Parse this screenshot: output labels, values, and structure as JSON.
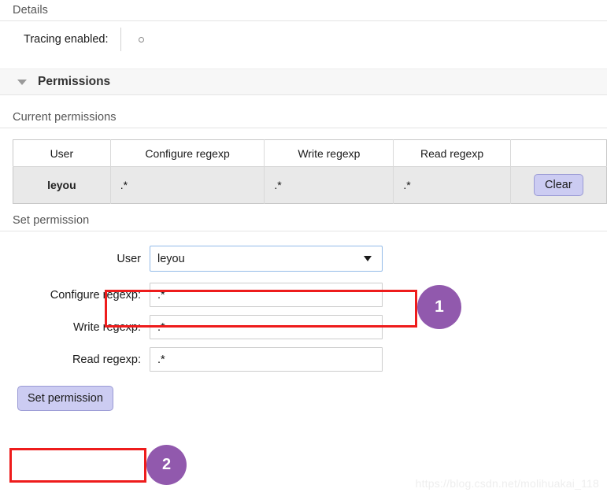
{
  "details": {
    "heading": "Details",
    "tracing_label": "Tracing enabled:",
    "tracing_value_icon": "small-circle-icon"
  },
  "permissions_section": {
    "title": "Permissions",
    "toggle_icon": "chevron-down-icon",
    "current_permissions_heading": "Current permissions",
    "table": {
      "columns": [
        "User",
        "Configure regexp",
        "Write regexp",
        "Read regexp",
        ""
      ],
      "rows": [
        {
          "user": "leyou",
          "configure_regexp": ".*",
          "write_regexp": ".*",
          "read_regexp": ".*",
          "action_label": "Clear"
        }
      ]
    }
  },
  "set_permission": {
    "heading": "Set permission",
    "user_label": "User",
    "user_value": "leyou",
    "user_options": [
      "leyou"
    ],
    "dropdown_icon": "triangle-down-icon",
    "fields": [
      {
        "label": "Configure regexp:",
        "value": ".*",
        "name": "configure-regexp-input"
      },
      {
        "label": "Write regexp:",
        "value": ".*",
        "name": "write-regexp-input"
      },
      {
        "label": "Read regexp:",
        "value": ".*",
        "name": "read-regexp-input"
      }
    ],
    "submit_label": "Set permission"
  },
  "annotations": {
    "badge_1": "1",
    "badge_2": "2",
    "highlight_color": "#ee1c1c",
    "badge_color": "#9159ad"
  },
  "watermark": "https://blog.csdn.net/molihuakai_118"
}
